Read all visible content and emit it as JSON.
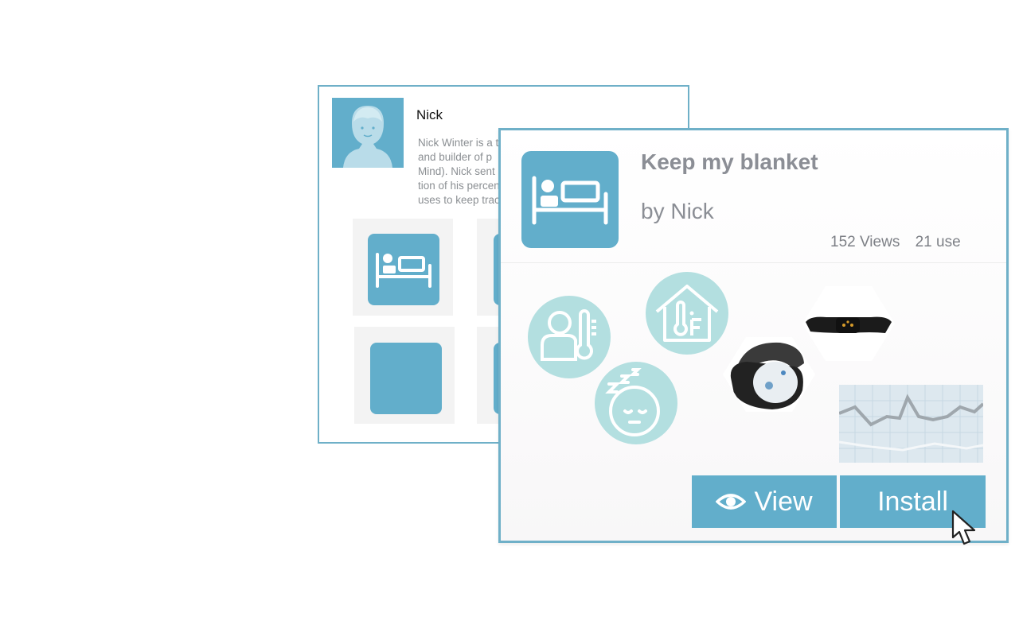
{
  "profile": {
    "name": "Nick",
    "bio": "Nick Winter is a t\nand builder of p\nMind). Nick sent\ntion of his percen\nuses to keep trac"
  },
  "recipe": {
    "title": "Keep my blanket",
    "author": "by Nick",
    "views": "152 Views",
    "uses": "21 use",
    "view_label": "View",
    "install_label": "Install"
  },
  "icons": {
    "avatar": "person-avatar-icon",
    "bed": "bed-icon",
    "person_temperature": "person-thermometer-icon",
    "home_temperature": "home-temperature-icon",
    "sleep": "sleeping-face-icon",
    "eye": "eye-icon"
  },
  "colors": {
    "accent": "#62aecb",
    "ingredient_circle": "#b3dfe0",
    "text_gray": "#8b8e95"
  }
}
